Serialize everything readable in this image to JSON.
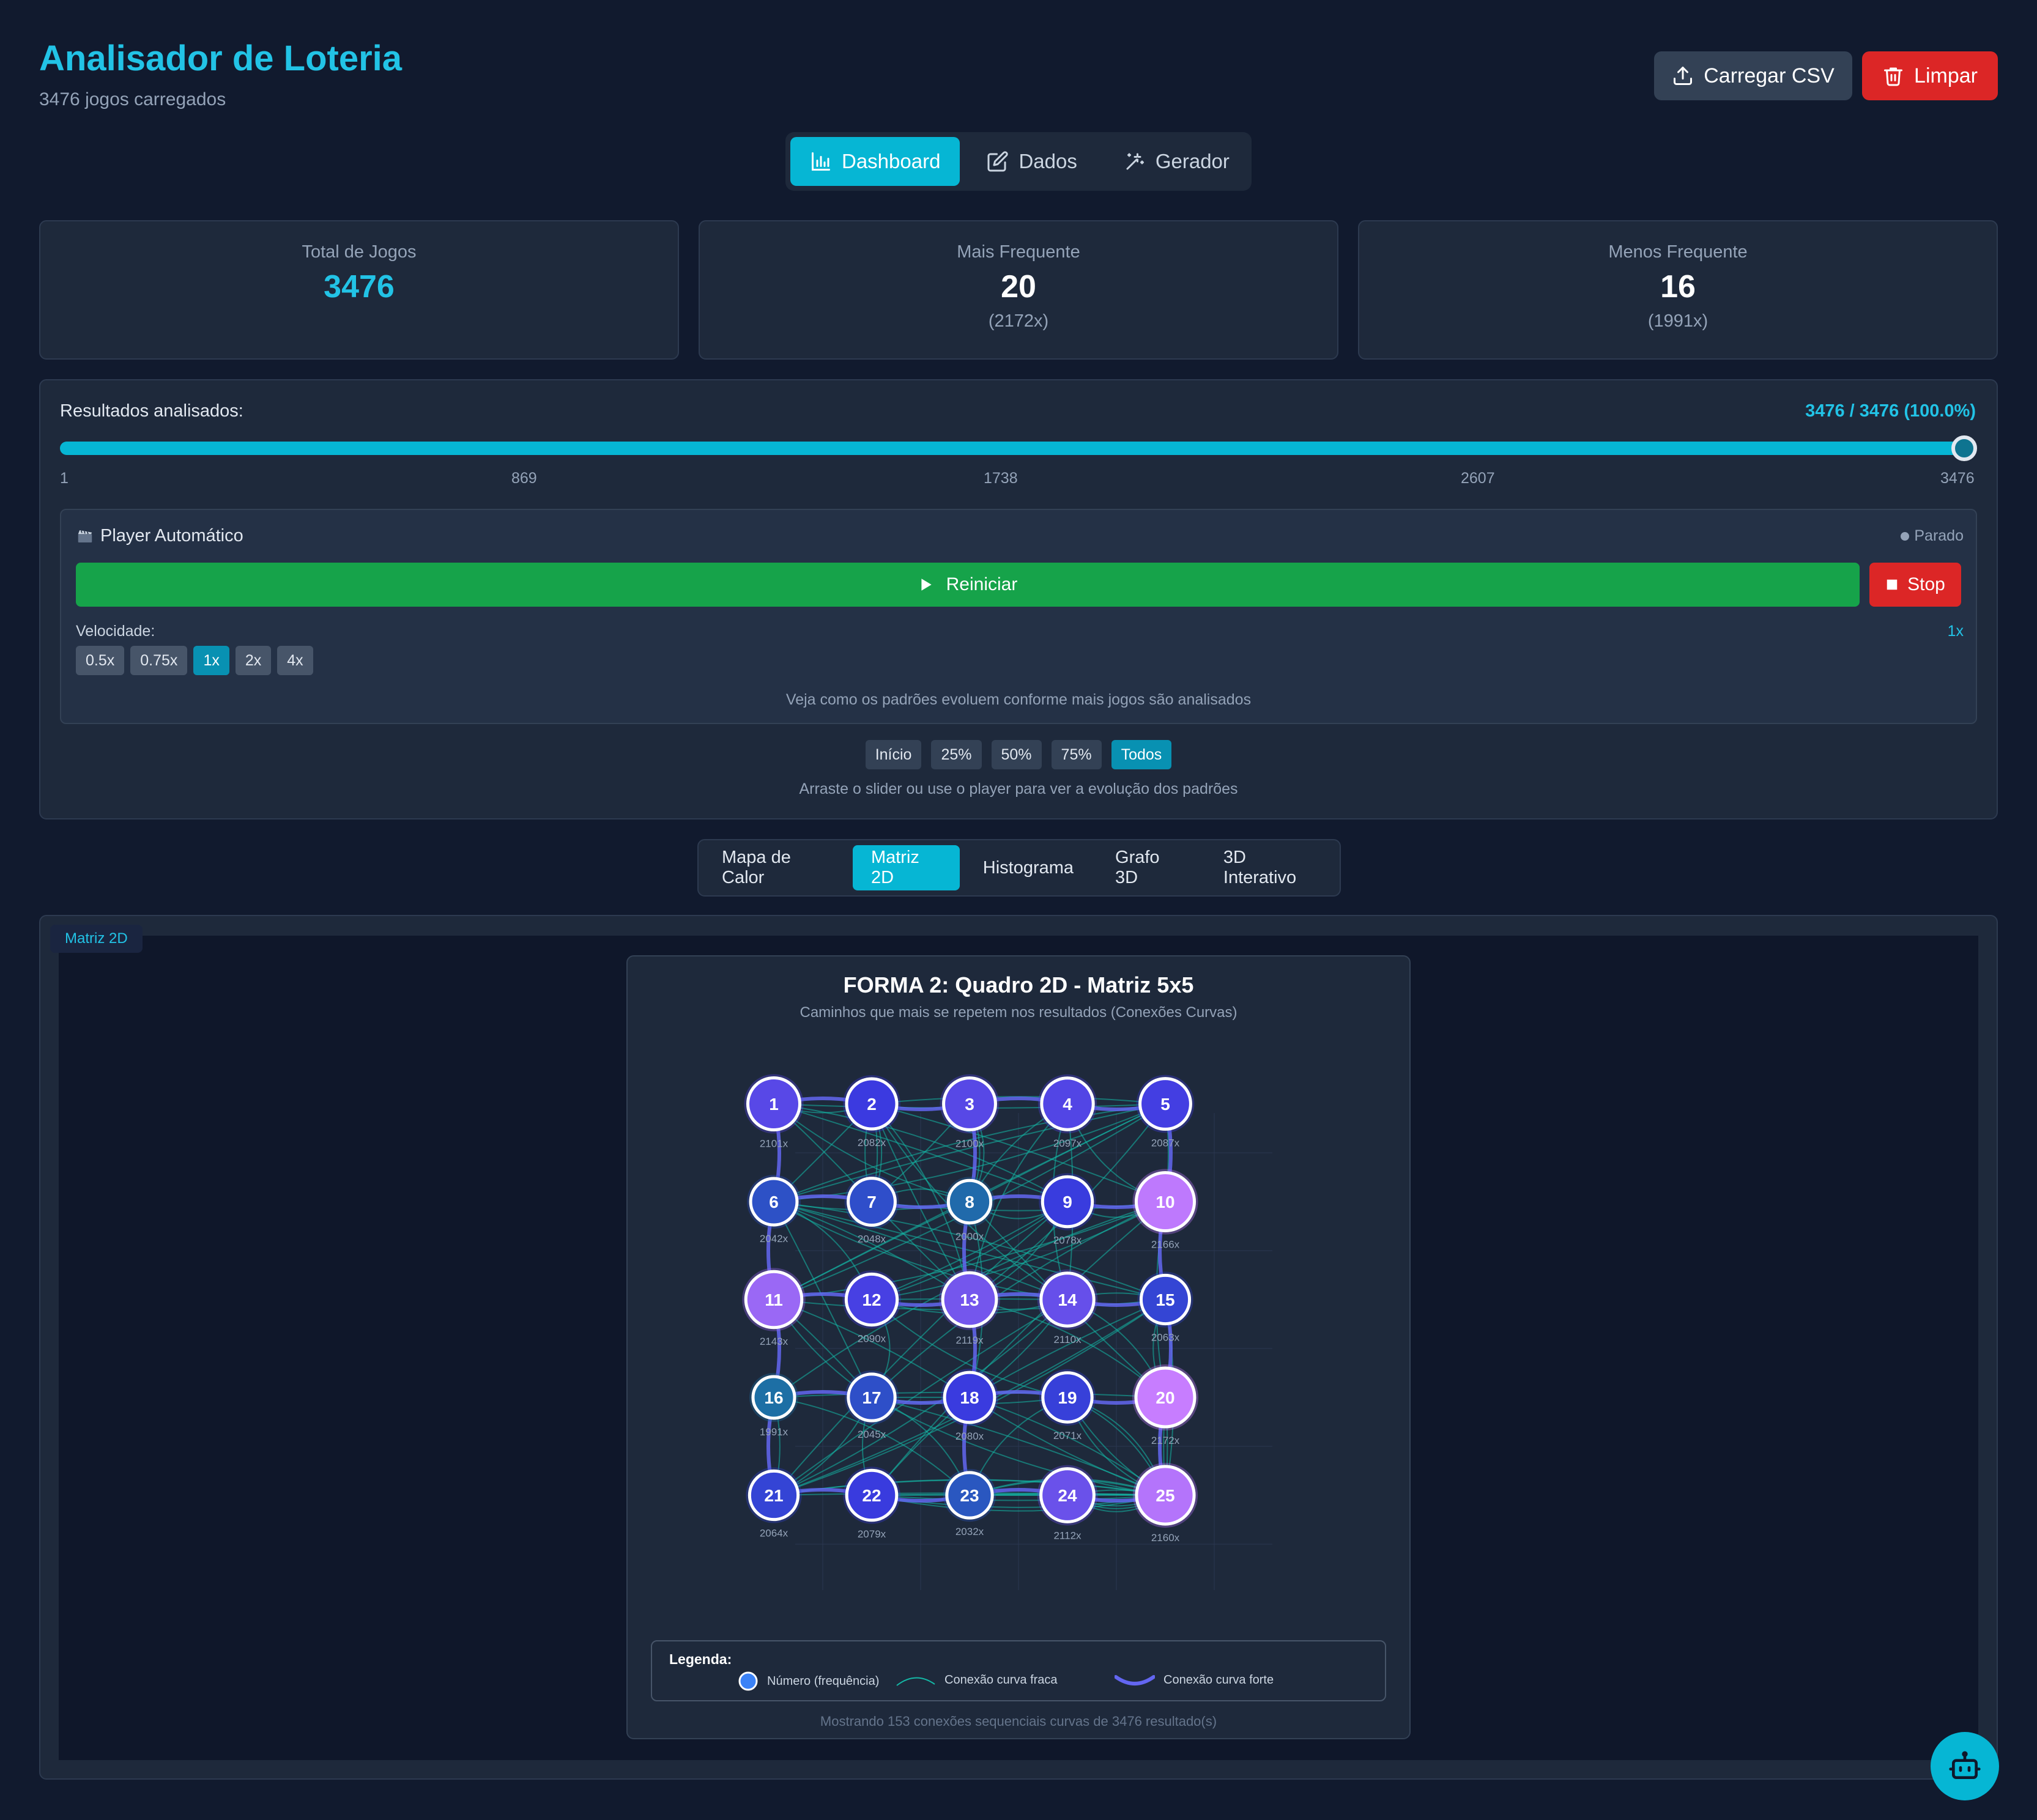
{
  "header": {
    "title": "Analisador de Loteria",
    "subtitle": "3476 jogos carregados",
    "upload_label": "Carregar CSV",
    "clear_label": "Limpar"
  },
  "nav": {
    "tabs": [
      "Dashboard",
      "Dados",
      "Gerador"
    ],
    "active": "Dashboard"
  },
  "stats": [
    {
      "label": "Total de Jogos",
      "value": "3476",
      "sub": ""
    },
    {
      "label": "Mais Frequente",
      "value": "20",
      "sub": "(2172x)"
    },
    {
      "label": "Menos Frequente",
      "value": "16",
      "sub": "(1991x)"
    }
  ],
  "analysis": {
    "label": "Resultados analisados:",
    "count": "3476 / 3476 (100.0%)",
    "slider_fraction": 1.0,
    "ticks": [
      "1",
      "869",
      "1738",
      "2607",
      "3476"
    ],
    "player": {
      "title": "Player Automático",
      "status": "Parado",
      "restart_label": "Reiniciar",
      "stop_label": "Stop",
      "speed_label": "Velocidade:",
      "speed_value": "1x",
      "speeds": [
        "0.5x",
        "0.75x",
        "1x",
        "2x",
        "4x"
      ],
      "active_speed": "1x",
      "hint": "Veja como os padrões evoluem conforme mais jogos são analisados"
    },
    "presets": [
      "Início",
      "25%",
      "50%",
      "75%",
      "Todos"
    ],
    "active_preset": "Todos",
    "preset_hint": "Arraste o slider ou use o player para ver a evolução dos padrões"
  },
  "views": {
    "tabs": [
      "Mapa de Calor",
      "Matriz 2D",
      "Histograma",
      "Grafo 3D",
      "3D Interativo"
    ],
    "active": "Matriz 2D"
  },
  "matrix": {
    "tag": "Matriz 2D",
    "title": "FORMA 2: Quadro 2D - Matriz 5x5",
    "subtitle": "Caminhos que mais se repetem nos resultados (Conexões Curvas)",
    "nodes": [
      {
        "n": "1",
        "freq": "2101x"
      },
      {
        "n": "2",
        "freq": "2082x"
      },
      {
        "n": "3",
        "freq": "2100x"
      },
      {
        "n": "4",
        "freq": "2097x"
      },
      {
        "n": "5",
        "freq": "2087x"
      },
      {
        "n": "6",
        "freq": "2042x"
      },
      {
        "n": "7",
        "freq": "2048x"
      },
      {
        "n": "8",
        "freq": "2000x"
      },
      {
        "n": "9",
        "freq": "2078x"
      },
      {
        "n": "10",
        "freq": "2166x"
      },
      {
        "n": "11",
        "freq": "2143x"
      },
      {
        "n": "12",
        "freq": "2090x"
      },
      {
        "n": "13",
        "freq": "2119x"
      },
      {
        "n": "14",
        "freq": "2110x"
      },
      {
        "n": "15",
        "freq": "2063x"
      },
      {
        "n": "16",
        "freq": "1991x"
      },
      {
        "n": "17",
        "freq": "2045x"
      },
      {
        "n": "18",
        "freq": "2080x"
      },
      {
        "n": "19",
        "freq": "2071x"
      },
      {
        "n": "20",
        "freq": "2172x"
      },
      {
        "n": "21",
        "freq": "2064x"
      },
      {
        "n": "22",
        "freq": "2079x"
      },
      {
        "n": "23",
        "freq": "2032x"
      },
      {
        "n": "24",
        "freq": "2112x"
      },
      {
        "n": "25",
        "freq": "2160x"
      }
    ],
    "legend": {
      "title": "Legenda:",
      "node": "Número (frequência)",
      "weak": "Conexão curva fraca",
      "strong": "Conexão curva forte"
    },
    "footnote": "Mostrando 153 conexões sequenciais curvas de 3476 resultado(s)",
    "colors": {
      "low": "#1d6fa5",
      "mid": "#3a3ae0",
      "high": "#c77dff",
      "weak_edge": "#14b8a6",
      "strong_edge": "#6366f1"
    }
  }
}
